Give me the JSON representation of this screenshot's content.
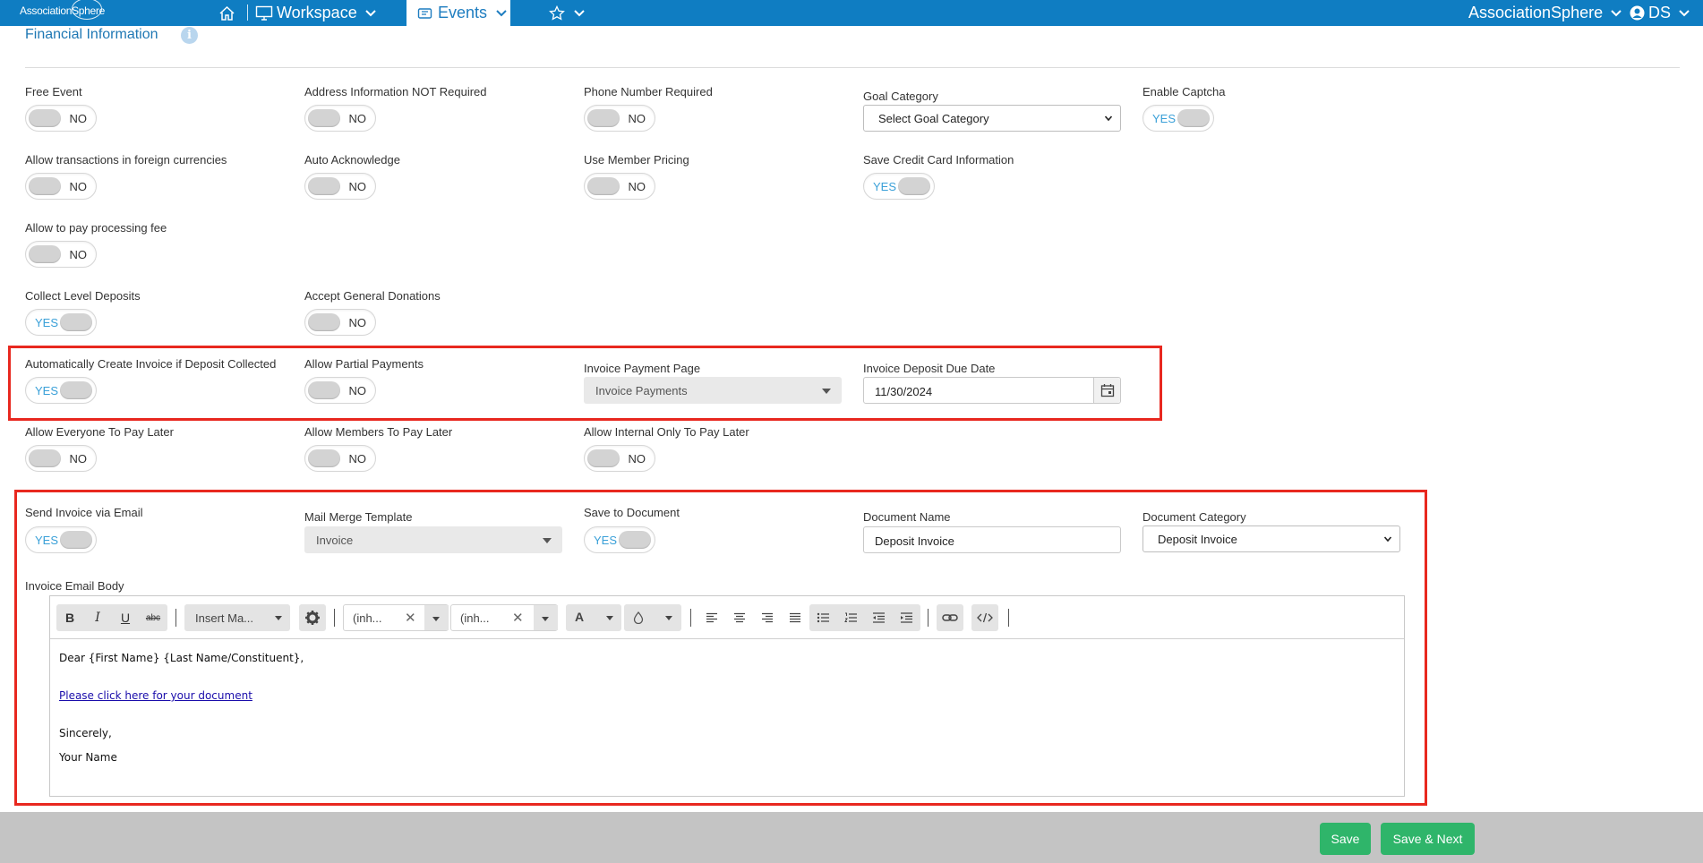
{
  "nav": {
    "brand": "AssociationSphere",
    "workspace_label": "Workspace",
    "events_label": "Events",
    "org_label": "AssociationSphere",
    "user_initials": "DS"
  },
  "section": {
    "title": "Financial Information"
  },
  "fields": {
    "free_event": {
      "label": "Free Event",
      "value": "NO"
    },
    "address_not_required": {
      "label": "Address Information NOT Required",
      "value": "NO"
    },
    "phone_required": {
      "label": "Phone Number Required",
      "value": "NO"
    },
    "goal_category": {
      "label": "Goal Category",
      "value": "Select Goal Category"
    },
    "enable_captcha": {
      "label": "Enable Captcha",
      "value": "YES"
    },
    "foreign_currencies": {
      "label": "Allow transactions in foreign currencies",
      "value": "NO"
    },
    "auto_acknowledge": {
      "label": "Auto Acknowledge",
      "value": "NO"
    },
    "member_pricing": {
      "label": "Use Member Pricing",
      "value": "NO"
    },
    "save_credit_card": {
      "label": "Save Credit Card Information",
      "value": "YES"
    },
    "processing_fee": {
      "label": "Allow to pay processing fee",
      "value": "NO"
    },
    "collect_level_deposits": {
      "label": "Collect Level Deposits",
      "value": "YES"
    },
    "accept_general_donations": {
      "label": "Accept General Donations",
      "value": "NO"
    },
    "auto_create_invoice": {
      "label": "Automatically Create Invoice if Deposit Collected",
      "value": "YES"
    },
    "partial_payments": {
      "label": "Allow Partial Payments",
      "value": "NO"
    },
    "invoice_payment_page": {
      "label": "Invoice Payment Page",
      "value": "Invoice Payments"
    },
    "invoice_deposit_due_date": {
      "label": "Invoice Deposit Due Date",
      "value": "11/30/2024"
    },
    "everyone_pay_later": {
      "label": "Allow Everyone To Pay Later",
      "value": "NO"
    },
    "members_pay_later": {
      "label": "Allow Members To Pay Later",
      "value": "NO"
    },
    "internal_pay_later": {
      "label": "Allow Internal Only To Pay Later",
      "value": "NO"
    },
    "send_invoice_email": {
      "label": "Send Invoice via Email",
      "value": "YES"
    },
    "mail_merge_template": {
      "label": "Mail Merge Template",
      "value": "Invoice"
    },
    "save_to_document": {
      "label": "Save to Document",
      "value": "YES"
    },
    "document_name": {
      "label": "Document Name",
      "value": "Deposit Invoice"
    },
    "document_category": {
      "label": "Document Category",
      "value": "Deposit Invoice"
    }
  },
  "editor": {
    "label": "Invoice Email Body",
    "toolbar": {
      "bold": "B",
      "italic": "I",
      "underline": "U",
      "strike": "abc",
      "insert_merge": "Insert Ma...",
      "font_family": "(inh...",
      "font_size": "(inh...",
      "font_color": "A"
    },
    "body": {
      "greeting": "Dear {First Name} {Last Name/Constituent},",
      "link": "Please click here for your document",
      "closing": "Sincerely,",
      "signature": "Your Name"
    }
  },
  "footer": {
    "save": "Save",
    "save_next": "Save & Next"
  },
  "colors": {
    "nav": "#0f7dc2",
    "accent": "#3aa0d8",
    "highlight": "#e8281f",
    "button": "#2fb56a"
  }
}
